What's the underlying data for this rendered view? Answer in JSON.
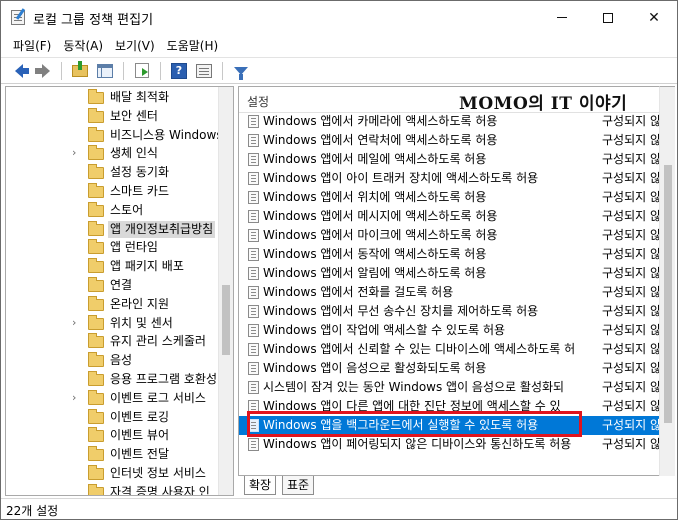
{
  "window": {
    "title": "로컬 그룹 정책 편집기"
  },
  "menu": [
    "파일(F)",
    "동작(A)",
    "보기(V)",
    "도움말(H)"
  ],
  "toolbar": {
    "help_glyph": "?"
  },
  "tree": {
    "items": [
      {
        "label": "배달 최적화",
        "expandable": false,
        "selected": false
      },
      {
        "label": "보안 센터",
        "expandable": false,
        "selected": false
      },
      {
        "label": "비즈니스용 Windows",
        "expandable": false,
        "selected": false
      },
      {
        "label": "생체 인식",
        "expandable": true,
        "selected": false
      },
      {
        "label": "설정 동기화",
        "expandable": false,
        "selected": false
      },
      {
        "label": "스마트 카드",
        "expandable": false,
        "selected": false
      },
      {
        "label": "스토어",
        "expandable": false,
        "selected": false
      },
      {
        "label": "앱 개인정보취급방침",
        "expandable": false,
        "selected": true
      },
      {
        "label": "앱 런타임",
        "expandable": false,
        "selected": false
      },
      {
        "label": "앱 패키지 배포",
        "expandable": false,
        "selected": false
      },
      {
        "label": "연결",
        "expandable": false,
        "selected": false
      },
      {
        "label": "온라인 지원",
        "expandable": false,
        "selected": false
      },
      {
        "label": "위치 및 센서",
        "expandable": true,
        "selected": false
      },
      {
        "label": "유지 관리 스케줄러",
        "expandable": false,
        "selected": false
      },
      {
        "label": "음성",
        "expandable": false,
        "selected": false
      },
      {
        "label": "응용 프로그램 호환성",
        "expandable": false,
        "selected": false
      },
      {
        "label": "이벤트 로그 서비스",
        "expandable": true,
        "selected": false
      },
      {
        "label": "이벤트 로깅",
        "expandable": false,
        "selected": false
      },
      {
        "label": "이벤트 뷰어",
        "expandable": false,
        "selected": false
      },
      {
        "label": "이벤트 전달",
        "expandable": false,
        "selected": false
      },
      {
        "label": "인터넷 정보 서비스",
        "expandable": false,
        "selected": false
      },
      {
        "label": "자격 증명 사용자 인",
        "expandable": false,
        "selected": false
      }
    ]
  },
  "list": {
    "header_setting": "설정",
    "watermark": "MOMO의 IT 이야기",
    "rows": [
      {
        "name": "Windows 앱에서 카메라에 액세스하도록 허용",
        "state": "구성되지 않",
        "selected": false
      },
      {
        "name": "Windows 앱에서 연락처에 액세스하도록 허용",
        "state": "구성되지 않",
        "selected": false
      },
      {
        "name": "Windows 앱에서 메일에 액세스하도록 허용",
        "state": "구성되지 않",
        "selected": false
      },
      {
        "name": "Windows 앱이 아이 트래커 장치에 액세스하도록 허용",
        "state": "구성되지 않",
        "selected": false
      },
      {
        "name": "Windows 앱에서 위치에 액세스하도록 허용",
        "state": "구성되지 않",
        "selected": false
      },
      {
        "name": "Windows 앱에서 메시지에 액세스하도록 허용",
        "state": "구성되지 않",
        "selected": false
      },
      {
        "name": "Windows 앱에서 마이크에 액세스하도록 허용",
        "state": "구성되지 않",
        "selected": false
      },
      {
        "name": "Windows 앱에서 동작에 액세스하도록 허용",
        "state": "구성되지 않",
        "selected": false
      },
      {
        "name": "Windows 앱에서 알림에 액세스하도록 허용",
        "state": "구성되지 않",
        "selected": false
      },
      {
        "name": "Windows 앱에서 전화를 걸도록 허용",
        "state": "구성되지 않",
        "selected": false
      },
      {
        "name": "Windows 앱에서 무선 송수신 장치를 제어하도록 허용",
        "state": "구성되지 않",
        "selected": false
      },
      {
        "name": "Windows 앱이 작업에 액세스할 수 있도록 허용",
        "state": "구성되지 않",
        "selected": false
      },
      {
        "name": "Windows 앱에서 신뢰할 수 있는 디바이스에 액세스하도록 허",
        "state": "구성되지 않",
        "selected": false
      },
      {
        "name": "Windows 앱이 음성으로 활성화되도록 허용",
        "state": "구성되지 않",
        "selected": false
      },
      {
        "name": "시스템이 잠겨 있는 동안 Windows 앱이 음성으로 활성화되",
        "state": "구성되지 않",
        "selected": false
      },
      {
        "name": "Windows 앱이 다른 앱에 대한 진단 정보에 액세스할 수 있",
        "state": "구성되지 않",
        "selected": false
      },
      {
        "name": "Windows 앱을 백그라운드에서 실행할 수 있도록 허용",
        "state": "구성되지 않",
        "selected": true
      },
      {
        "name": "Windows 앱이 페어링되지 않은 디바이스와 통신하도록 허용",
        "state": "구성되지 않",
        "selected": false
      }
    ]
  },
  "tabs": [
    "확장",
    "표준"
  ],
  "status": {
    "text": "22개 설정"
  },
  "colors": {
    "selection": "#0078d7",
    "highlight_box": "#e0141e",
    "folder": "#f0cd6a"
  }
}
